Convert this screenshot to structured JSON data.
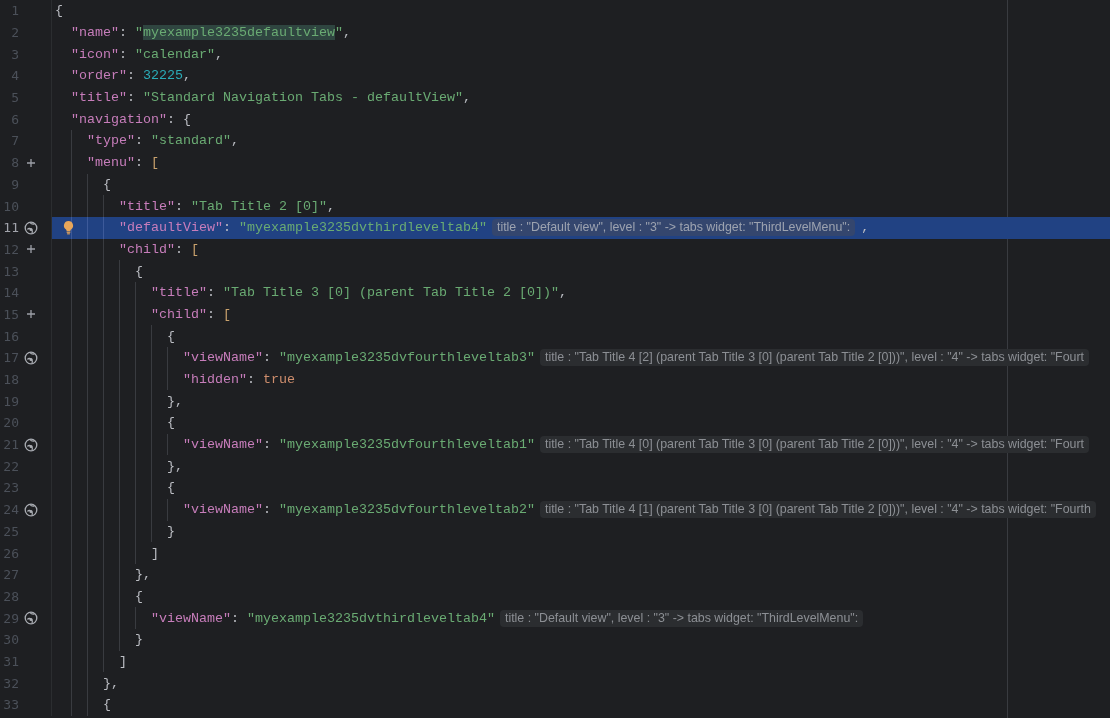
{
  "editor": {
    "lines": [
      {
        "number": "1",
        "selected": false,
        "tokens": [
          {
            "kind": "punct",
            "text": "{"
          }
        ]
      },
      {
        "number": "2",
        "selected": false,
        "tokens": [
          {
            "kind": "key",
            "text": "\"name\""
          },
          {
            "kind": "punct",
            "text": ": "
          },
          {
            "kind": "string",
            "text": "\""
          },
          {
            "kind": "match",
            "text": "myexample3235defaultview"
          },
          {
            "kind": "string",
            "text": "\""
          },
          {
            "kind": "punct",
            "text": ","
          }
        ]
      },
      {
        "number": "3",
        "selected": false,
        "tokens": [
          {
            "kind": "key",
            "text": "\"icon\""
          },
          {
            "kind": "punct",
            "text": ": "
          },
          {
            "kind": "string",
            "text": "\"calendar\""
          },
          {
            "kind": "punct",
            "text": ","
          }
        ]
      },
      {
        "number": "4",
        "selected": false,
        "tokens": [
          {
            "kind": "key",
            "text": "\"order\""
          },
          {
            "kind": "punct",
            "text": ": "
          },
          {
            "kind": "number",
            "text": "32225"
          },
          {
            "kind": "punct",
            "text": ","
          }
        ]
      },
      {
        "number": "5",
        "selected": false,
        "tokens": [
          {
            "kind": "key",
            "text": "\"title\""
          },
          {
            "kind": "punct",
            "text": ": "
          },
          {
            "kind": "string",
            "text": "\"Standard Navigation Tabs - defaultView\""
          },
          {
            "kind": "punct",
            "text": ","
          }
        ]
      },
      {
        "number": "6",
        "selected": false,
        "tokens": [
          {
            "kind": "key",
            "text": "\"navigation\""
          },
          {
            "kind": "punct",
            "text": ": {"
          }
        ]
      },
      {
        "number": "7",
        "selected": false,
        "tokens": [
          {
            "kind": "key",
            "text": "\"type\""
          },
          {
            "kind": "punct",
            "text": ": "
          },
          {
            "kind": "string",
            "text": "\"standard\""
          },
          {
            "kind": "punct",
            "text": ","
          }
        ]
      },
      {
        "number": "8",
        "selected": false,
        "kind": "fold",
        "tokens": [
          {
            "kind": "key",
            "text": "\"menu\""
          },
          {
            "kind": "punct",
            "text": ": "
          },
          {
            "kind": "bracket",
            "text": "["
          }
        ]
      },
      {
        "number": "9",
        "selected": false,
        "tokens": [
          {
            "kind": "punct",
            "text": "{"
          }
        ]
      },
      {
        "number": "10",
        "selected": false,
        "tokens": [
          {
            "kind": "key",
            "text": "\"title\""
          },
          {
            "kind": "punct",
            "text": ": "
          },
          {
            "kind": "string",
            "text": "\"Tab Title 2 [0]\""
          },
          {
            "kind": "punct",
            "text": ","
          }
        ]
      },
      {
        "number": "11",
        "selected": true,
        "kind": "globe",
        "tokens": [
          {
            "kind": "key",
            "text": "\"defaultView\""
          },
          {
            "kind": "punct",
            "text": ": "
          },
          {
            "kind": "string",
            "text": "\"myexample3235dvthirdleveltab4\""
          },
          {
            "kind": "hint",
            "text": "title : \"Default view\", level : \"3\" -> tabs widget: \"ThirdLevelMenu\":"
          },
          {
            "kind": "punct",
            "text": ","
          }
        ]
      },
      {
        "number": "12",
        "selected": false,
        "kind": "fold",
        "tokens": [
          {
            "kind": "key",
            "text": "\"child\""
          },
          {
            "kind": "punct",
            "text": ": "
          },
          {
            "kind": "bracket",
            "text": "["
          }
        ]
      },
      {
        "number": "13",
        "selected": false,
        "tokens": [
          {
            "kind": "punct",
            "text": "{"
          }
        ]
      },
      {
        "number": "14",
        "selected": false,
        "tokens": [
          {
            "kind": "key",
            "text": "\"title\""
          },
          {
            "kind": "punct",
            "text": ": "
          },
          {
            "kind": "string",
            "text": "\"Tab Title 3 [0] (parent Tab Title 2 [0])\""
          },
          {
            "kind": "punct",
            "text": ","
          }
        ]
      },
      {
        "number": "15",
        "selected": false,
        "kind": "fold",
        "tokens": [
          {
            "kind": "key",
            "text": "\"child\""
          },
          {
            "kind": "punct",
            "text": ": "
          },
          {
            "kind": "bracket",
            "text": "["
          }
        ]
      },
      {
        "number": "16",
        "selected": false,
        "tokens": [
          {
            "kind": "punct",
            "text": "{"
          }
        ]
      },
      {
        "number": "17",
        "selected": false,
        "kind": "globe",
        "tokens": [
          {
            "kind": "key",
            "text": "\"viewName\""
          },
          {
            "kind": "punct",
            "text": ": "
          },
          {
            "kind": "string",
            "text": "\"myexample3235dvfourthleveltab3\""
          },
          {
            "kind": "hint",
            "text": "title : \"Tab Title 4 [2] (parent Tab Title 3 [0] (parent Tab Title 2 [0]))\", level : \"4\" -> tabs widget: \"Fourt"
          }
        ]
      },
      {
        "number": "18",
        "selected": false,
        "tokens": [
          {
            "kind": "key",
            "text": "\"hidden\""
          },
          {
            "kind": "punct",
            "text": ": "
          },
          {
            "kind": "keyword",
            "text": "true"
          }
        ]
      },
      {
        "number": "19",
        "selected": false,
        "tokens": [
          {
            "kind": "punct",
            "text": "},"
          }
        ]
      },
      {
        "number": "20",
        "selected": false,
        "tokens": [
          {
            "kind": "punct",
            "text": "{"
          }
        ]
      },
      {
        "number": "21",
        "selected": false,
        "kind": "globe",
        "tokens": [
          {
            "kind": "key",
            "text": "\"viewName\""
          },
          {
            "kind": "punct",
            "text": ": "
          },
          {
            "kind": "string",
            "text": "\"myexample3235dvfourthleveltab1\""
          },
          {
            "kind": "hint",
            "text": "title : \"Tab Title 4 [0] (parent Tab Title 3 [0] (parent Tab Title 2 [0]))\", level : \"4\" -> tabs widget: \"Fourt"
          }
        ]
      },
      {
        "number": "22",
        "selected": false,
        "tokens": [
          {
            "kind": "punct",
            "text": "},"
          }
        ]
      },
      {
        "number": "23",
        "selected": false,
        "tokens": [
          {
            "kind": "punct",
            "text": "{"
          }
        ]
      },
      {
        "number": "24",
        "selected": false,
        "kind": "globe",
        "tokens": [
          {
            "kind": "key",
            "text": "\"viewName\""
          },
          {
            "kind": "punct",
            "text": ": "
          },
          {
            "kind": "string",
            "text": "\"myexample3235dvfourthleveltab2\""
          },
          {
            "kind": "hint",
            "text": "title : \"Tab Title 4 [1] (parent Tab Title 3 [0] (parent Tab Title 2 [0]))\", level : \"4\" -> tabs widget: \"Fourth"
          }
        ]
      },
      {
        "number": "25",
        "selected": false,
        "tokens": [
          {
            "kind": "punct",
            "text": "}"
          }
        ]
      },
      {
        "number": "26",
        "selected": false,
        "tokens": [
          {
            "kind": "punct",
            "text": "]"
          }
        ]
      },
      {
        "number": "27",
        "selected": false,
        "tokens": [
          {
            "kind": "punct",
            "text": "},"
          }
        ]
      },
      {
        "number": "28",
        "selected": false,
        "tokens": [
          {
            "kind": "punct",
            "text": "{"
          }
        ]
      },
      {
        "number": "29",
        "selected": false,
        "kind": "globe",
        "tokens": [
          {
            "kind": "key",
            "text": "\"viewName\""
          },
          {
            "kind": "punct",
            "text": ": "
          },
          {
            "kind": "string",
            "text": "\"myexample3235dvthirdleveltab4\""
          },
          {
            "kind": "hint",
            "text": "title : \"Default view\", level : \"3\" -> tabs widget: \"ThirdLevelMenu\":"
          }
        ]
      },
      {
        "number": "30",
        "selected": false,
        "tokens": [
          {
            "kind": "punct",
            "text": "}"
          }
        ]
      },
      {
        "number": "31",
        "selected": false,
        "tokens": [
          {
            "kind": "punct",
            "text": "]"
          }
        ]
      },
      {
        "number": "32",
        "selected": false,
        "tokens": [
          {
            "kind": "punct",
            "text": "},"
          }
        ]
      },
      {
        "number": "33",
        "selected": false,
        "tokens": [
          {
            "kind": "punct",
            "text": "{"
          }
        ]
      }
    ]
  }
}
